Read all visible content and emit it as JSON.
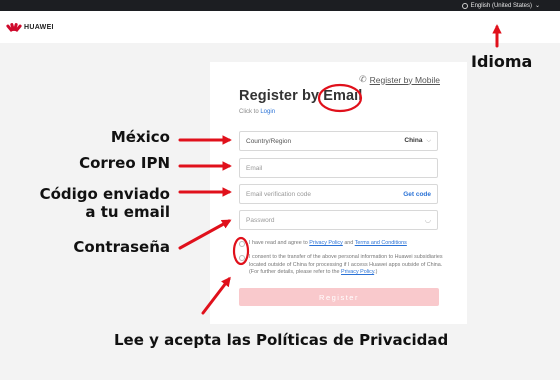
{
  "topbar": {
    "language": "English (United States)",
    "language_icon": "globe-icon",
    "chevron": "⌄"
  },
  "header": {
    "logo_text": "HUAWEI"
  },
  "form": {
    "register_by_phone": "Register by Mobile",
    "phone_icon": "phone-icon",
    "title": "Register by Email",
    "login_prefix": "Click to",
    "login_link": "Login",
    "country_placeholder": "Country/Region",
    "country_value": "China",
    "email_placeholder": "Email",
    "code_placeholder": "Email verification code",
    "get_code": "Get code",
    "password_placeholder": "Password",
    "agree_prefix": "I have read and agree to",
    "privacy_link": "Privacy Policy",
    "and_text": "and",
    "terms_link": "Terms and Conditions",
    "consent_text": "I consent to the transfer of the above personal information to Huawei subsidiaries located outside of China for processing if I access Huawei apps outside of China. (For further details, please refer to the",
    "consent_privacy_link": "Privacy Policy",
    "consent_end": ".)",
    "register_button": "Register"
  },
  "annotations": {
    "idioma": "Idioma",
    "mexico": "México",
    "correo": "Correo IPN",
    "codigo_line1": "Código enviado",
    "codigo_line2": "a tu email",
    "contrasena": "Contraseña",
    "lee": "Lee y acepta las Políticas de Privacidad"
  },
  "colors": {
    "brand_red": "#cf0a2c",
    "link_blue": "#2a72d6",
    "annotation_red": "#e0101b",
    "button_disabled": "#f9c9cc"
  }
}
